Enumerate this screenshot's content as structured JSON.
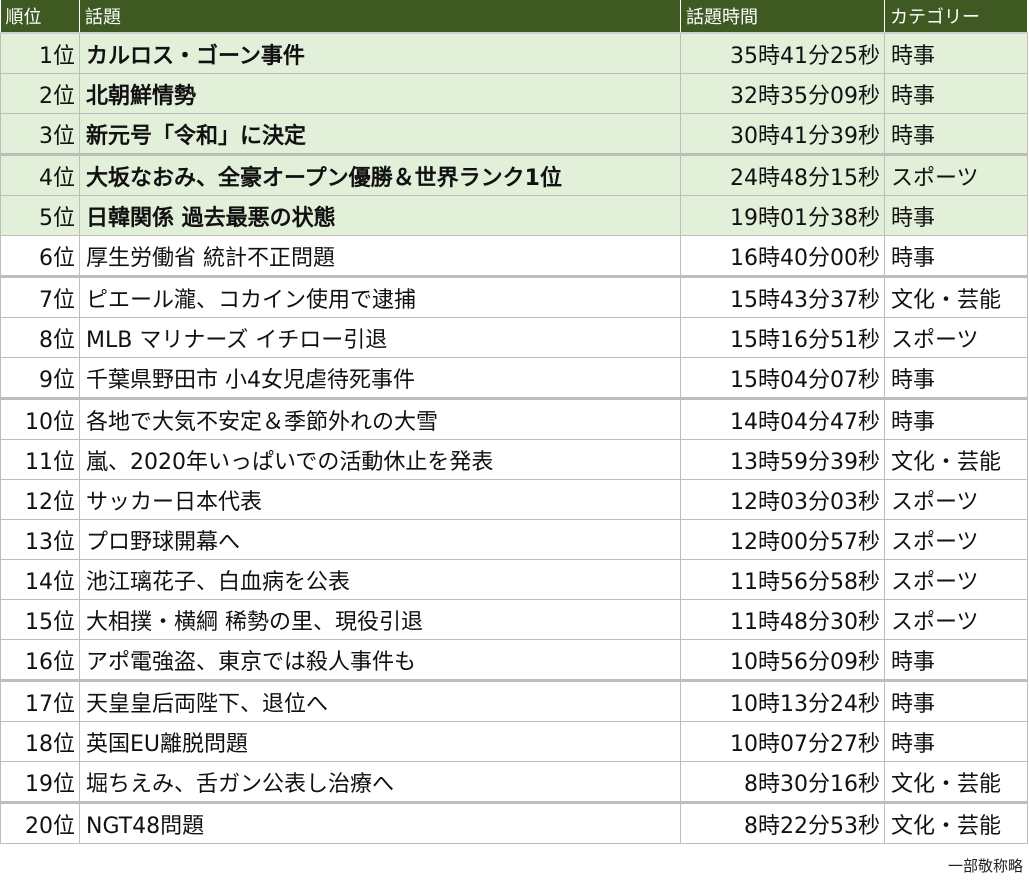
{
  "headers": {
    "rank": "順位",
    "topic": "話題",
    "time": "話題時間",
    "category": "カテゴリー"
  },
  "rows": [
    {
      "rank": "1位",
      "topic": "カルロス・ゴーン事件",
      "time": "35時41分25秒",
      "category": "時事"
    },
    {
      "rank": "2位",
      "topic": "北朝鮮情勢",
      "time": "32時35分09秒",
      "category": "時事"
    },
    {
      "rank": "3位",
      "topic": "新元号「令和」に決定",
      "time": "30時41分39秒",
      "category": "時事"
    },
    {
      "rank": "4位",
      "topic": "大坂なおみ、全豪オープン優勝＆世界ランク1位",
      "time": "24時48分15秒",
      "category": "スポーツ"
    },
    {
      "rank": "5位",
      "topic": "日韓関係 過去最悪の状態",
      "time": "19時01分38秒",
      "category": "時事"
    },
    {
      "rank": "6位",
      "topic": "厚生労働省 統計不正問題",
      "time": "16時40分00秒",
      "category": "時事"
    },
    {
      "rank": "7位",
      "topic": "ピエール瀧、コカイン使用で逮捕",
      "time": "15時43分37秒",
      "category": "文化・芸能"
    },
    {
      "rank": "8位",
      "topic": "MLB マリナーズ イチロー引退",
      "time": "15時16分51秒",
      "category": "スポーツ"
    },
    {
      "rank": "9位",
      "topic": "千葉県野田市 小4女児虐待死事件",
      "time": "15時04分07秒",
      "category": "時事"
    },
    {
      "rank": "10位",
      "topic": "各地で大気不安定＆季節外れの大雪",
      "time": "14時04分47秒",
      "category": "時事"
    },
    {
      "rank": "11位",
      "topic": "嵐、2020年いっぱいでの活動休止を発表",
      "time": "13時59分39秒",
      "category": "文化・芸能"
    },
    {
      "rank": "12位",
      "topic": "サッカー日本代表",
      "time": "12時03分03秒",
      "category": "スポーツ"
    },
    {
      "rank": "13位",
      "topic": "プロ野球開幕へ",
      "time": "12時00分57秒",
      "category": "スポーツ"
    },
    {
      "rank": "14位",
      "topic": "池江璃花子、白血病を公表",
      "time": "11時56分58秒",
      "category": "スポーツ"
    },
    {
      "rank": "15位",
      "topic": "大相撲・横綱 稀勢の里、現役引退",
      "time": "11時48分30秒",
      "category": "スポーツ"
    },
    {
      "rank": "16位",
      "topic": "アポ電強盗、東京では殺人事件も",
      "time": "10時56分09秒",
      "category": "時事"
    },
    {
      "rank": "17位",
      "topic": "天皇皇后両陛下、退位へ",
      "time": "10時13分24秒",
      "category": "時事"
    },
    {
      "rank": "18位",
      "topic": "英国EU離脱問題",
      "time": "10時07分27秒",
      "category": "時事"
    },
    {
      "rank": "19位",
      "topic": "堀ちえみ、舌ガン公表し治療へ",
      "time": "8時30分16秒",
      "category": "文化・芸能"
    },
    {
      "rank": "20位",
      "topic": "NGT48問題",
      "time": "8時22分53秒",
      "category": "文化・芸能"
    }
  ],
  "footnote": "一部敬称略",
  "colors": {
    "header_bg": "#3e5a22",
    "top5_bg": "#e2efd9"
  }
}
